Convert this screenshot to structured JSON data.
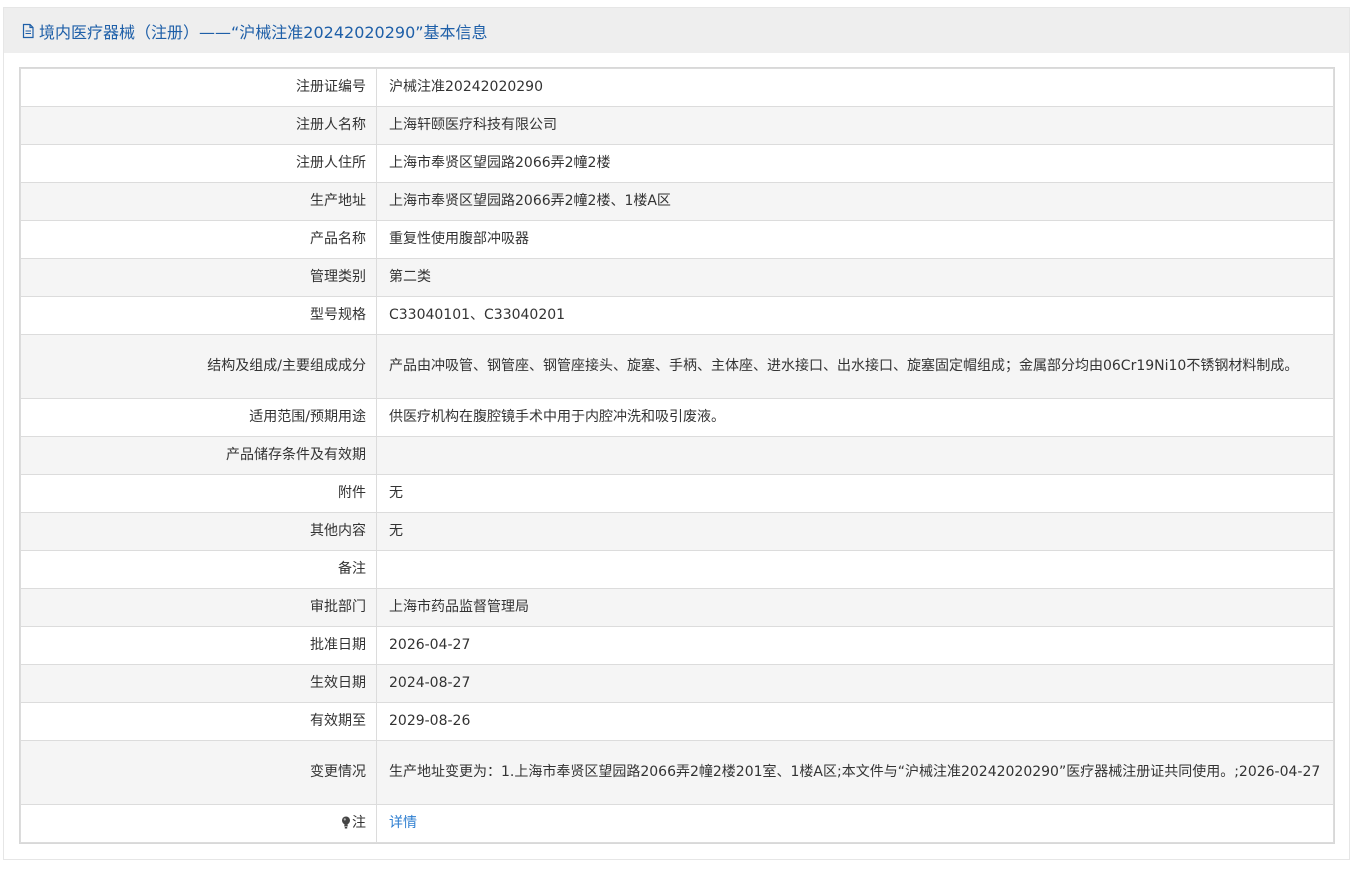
{
  "header": {
    "icon": "document-icon",
    "title": "境内医疗器械（注册）——“沪械注准20242020290”基本信息"
  },
  "rows": [
    {
      "label": "注册证编号",
      "value": "沪械注准20242020290"
    },
    {
      "label": "注册人名称",
      "value": "上海轩颐医疗科技有限公司"
    },
    {
      "label": "注册人住所",
      "value": "上海市奉贤区望园路2066弄2幢2楼"
    },
    {
      "label": "生产地址",
      "value": "上海市奉贤区望园路2066弄2幢2楼、1楼A区"
    },
    {
      "label": "产品名称",
      "value": "重复性使用腹部冲吸器"
    },
    {
      "label": "管理类别",
      "value": "第二类"
    },
    {
      "label": "型号规格",
      "value": "C33040101、C33040201"
    },
    {
      "label": "结构及组成/主要组成成分",
      "value": "产品由冲吸管、钢管座、钢管座接头、旋塞、手柄、主体座、进水接口、出水接口、旋塞固定帽组成；金属部分均由06Cr19Ni10不锈钢材料制成。"
    },
    {
      "label": "适用范围/预期用途",
      "value": "供医疗机构在腹腔镜手术中用于内腔冲洗和吸引废液。"
    },
    {
      "label": "产品储存条件及有效期",
      "value": ""
    },
    {
      "label": "附件",
      "value": "无"
    },
    {
      "label": "其他内容",
      "value": "无"
    },
    {
      "label": "备注",
      "value": ""
    },
    {
      "label": "审批部门",
      "value": "上海市药品监督管理局"
    },
    {
      "label": "批准日期",
      "value": "2026-04-27"
    },
    {
      "label": "生效日期",
      "value": "2024-08-27"
    },
    {
      "label": "有效期至",
      "value": "2029-08-26"
    },
    {
      "label": "变更情况",
      "value": "生产地址变更为：1.上海市奉贤区望园路2066弄2幢2楼201室、1楼A区;本文件与“沪械注准20242020290”医疗器械注册证共同使用。;2026-04-27"
    }
  ],
  "note": {
    "icon": "lightbulb-icon",
    "label": "注",
    "link_text": "详情"
  },
  "colors": {
    "title": "#1e5fa8",
    "link": "#2f7fd1",
    "header_bg": "#eeeeee",
    "row_alt_bg": "#f5f5f5",
    "border": "#dcdcdc",
    "text": "#333333"
  }
}
